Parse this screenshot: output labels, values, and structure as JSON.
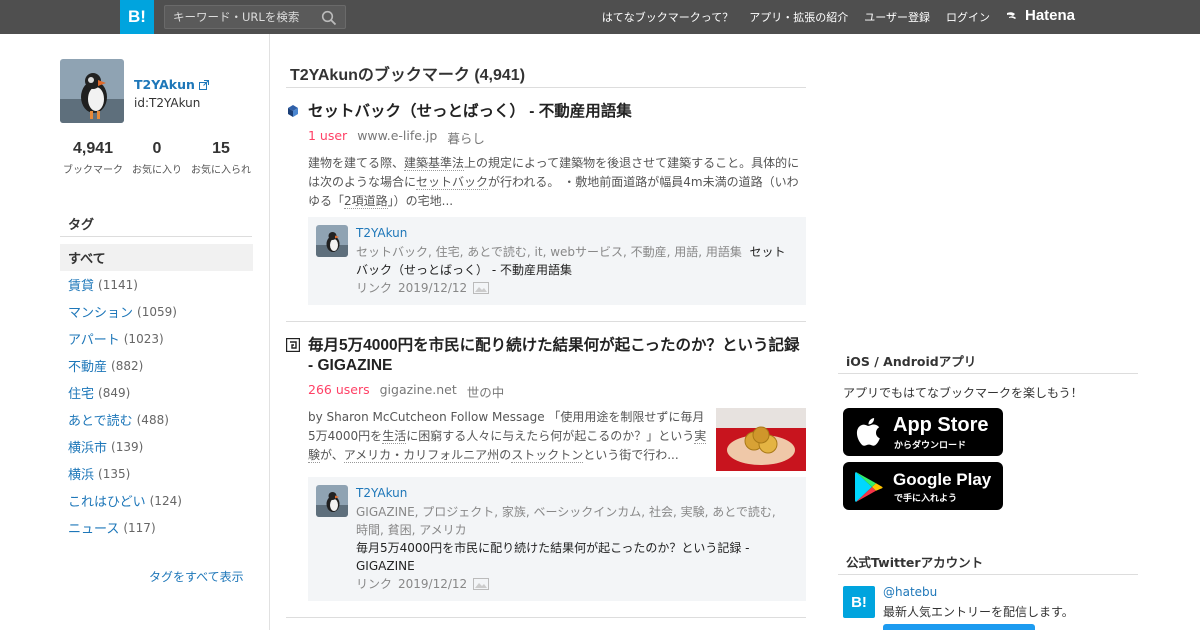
{
  "header": {
    "logo_text": "B!",
    "search_placeholder": "キーワード・URLを検索",
    "nav": [
      "はてなブックマークって？",
      "アプリ・拡張の紹介",
      "ユーザー登録",
      "ログイン"
    ],
    "brand": "Hatena",
    "bg_color": "#4f4f4f",
    "logo_color": "#00a4de"
  },
  "profile": {
    "name": "T2YAkun",
    "id": "id:T2YAkun",
    "stats": [
      {
        "num": "4,941",
        "label": "ブックマーク"
      },
      {
        "num": "0",
        "label": "お気に入り"
      },
      {
        "num": "15",
        "label": "お気に入られ"
      }
    ]
  },
  "tags": {
    "title": "タグ",
    "all_label": "すべて",
    "items": [
      {
        "name": "賃貸",
        "count": "(1141)"
      },
      {
        "name": "マンション",
        "count": "(1059)"
      },
      {
        "name": "アパート",
        "count": "(1023)"
      },
      {
        "name": "不動産",
        "count": "(882)"
      },
      {
        "name": "住宅",
        "count": "(849)"
      },
      {
        "name": "あとで読む",
        "count": "(488)"
      },
      {
        "name": "横浜市",
        "count": "(139)"
      },
      {
        "name": "横浜",
        "count": "(135)"
      },
      {
        "name": "これはひどい",
        "count": "(124)"
      },
      {
        "name": "ニュース",
        "count": "(117)"
      }
    ],
    "show_all": "タグをすべて表示"
  },
  "main": {
    "title": "T2YAkunのブックマーク (4,941)",
    "entries": [
      {
        "title": "セットバック（せっとばっく） - 不動産用語集",
        "users": "1 user",
        "domain": "www.e-life.jp",
        "category": "暮らし",
        "summary_parts": [
          {
            "t": "建物を建てる際、",
            "u": false
          },
          {
            "t": "建築基準法",
            "u": true
          },
          {
            "t": "上の規定によって建築物を後退させて建築すること。具体的には次のような場合に",
            "u": false
          },
          {
            "t": "セットバック",
            "u": true
          },
          {
            "t": "が行われる。 ・敷地前面道路が幅員4m未満の道路（いわゆる「",
            "u": false
          },
          {
            "t": "2項道路",
            "u": true
          },
          {
            "t": "」）の宅地...",
            "u": false
          }
        ],
        "user": "T2YAkun",
        "tags_text": "セットバック, 住宅, あとで読む, it, webサービス, 不動産, 用語, 用語集",
        "comment": "セットバック（せっとばっく） - 不動産用語集",
        "link_label": "リンク",
        "date": "2019/12/12"
      },
      {
        "title": "毎月5万4000円を市民に配り続けた結果何が起こったのか？という記録 - GIGAZINE",
        "users": "266 users",
        "domain": "gigazine.net",
        "category": "世の中",
        "summary_parts": [
          {
            "t": "by Sharon McCutcheon Follow Message 「使用用途を制限せずに毎月5万4000円を",
            "u": false
          },
          {
            "t": "生活",
            "u": true
          },
          {
            "t": "に困窮する人々に与えたら何が起こるのか？」という",
            "u": false
          },
          {
            "t": "実験",
            "u": true
          },
          {
            "t": "が、",
            "u": false
          },
          {
            "t": "アメリカ・カリフォルニア州",
            "u": true
          },
          {
            "t": "の",
            "u": false
          },
          {
            "t": "ストックトン",
            "u": true
          },
          {
            "t": "という街で行わ...",
            "u": false
          }
        ],
        "user": "T2YAkun",
        "tags_text": "GIGAZINE, プロジェクト, 家族, ベーシックインカム, 社会, 実験, あとで読む, 時間, 貧困, アメリカ",
        "comment": "毎月5万4000円を市民に配り続けた結果何が起こったのか？という記録 - GIGAZINE",
        "link_label": "リンク",
        "date": "2019/12/12"
      }
    ]
  },
  "right": {
    "apps_title": "iOS / Androidアプリ",
    "apps_text": "アプリでもはてなブックマークを楽しもう！",
    "appstore_top": "App Store",
    "appstore_sub": "からダウンロード",
    "gplay_top": "Google Play",
    "gplay_sub": "で手に入れよう",
    "twitter_title": "公式Twitterアカウント",
    "twitter_logo": "B!",
    "twitter_handle": "@hatebu",
    "twitter_desc": "最新人気エントリーを配信します。"
  },
  "colors": {
    "link": "#1e77b9",
    "users": "#ff4166",
    "comment_box": "#f3f5f7"
  }
}
